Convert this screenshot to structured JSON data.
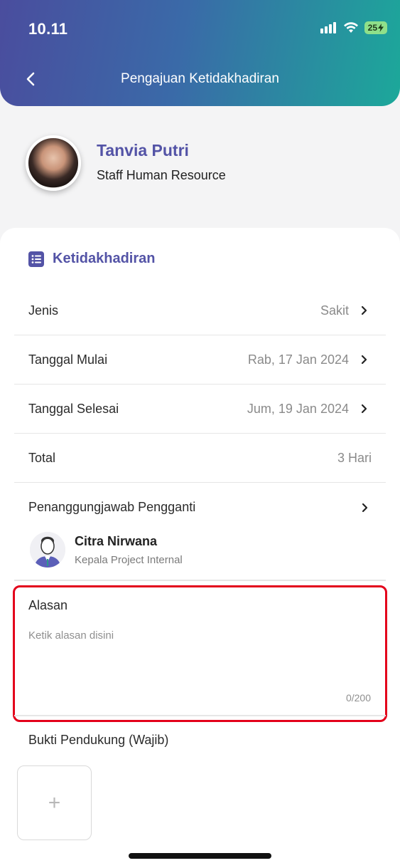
{
  "status_bar": {
    "time": "10.11",
    "battery": "25"
  },
  "header": {
    "title": "Pengajuan Ketidakhadiran"
  },
  "profile": {
    "name": "Tanvia Putri",
    "role": "Staff Human Resource"
  },
  "section": {
    "title": "Ketidakhadiran"
  },
  "fields": [
    {
      "label": "Jenis",
      "value": "Sakit"
    },
    {
      "label": "Tanggal Mulai",
      "value": "Rab, 17 Jan 2024"
    },
    {
      "label": "Tanggal Selesai",
      "value": "Jum, 19 Jan 2024"
    },
    {
      "label": "Total",
      "value": "3 Hari"
    }
  ],
  "substitute": {
    "label": "Penanggungjawab Pengganti",
    "name": "Citra Nirwana",
    "role": "Kepala Project Internal"
  },
  "reason": {
    "label": "Alasan",
    "placeholder": "Ketik alasan disini",
    "value": "",
    "counter": "0/200"
  },
  "proof": {
    "label": "Bukti Pendukung (Wajib)",
    "add_symbol": "+"
  },
  "colors": {
    "accent": "#5353a6",
    "highlight_border": "#e3001b",
    "header_start": "#4a4d9e",
    "header_end": "#1ca89a"
  }
}
